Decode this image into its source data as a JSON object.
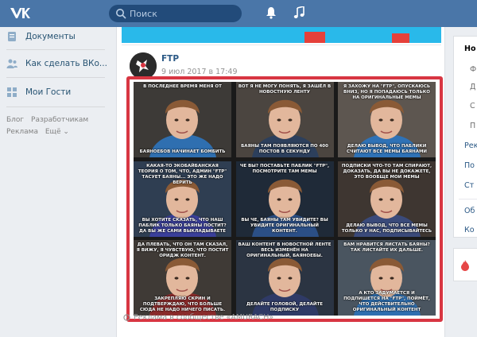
{
  "header": {
    "logo": "VK",
    "search_placeholder": "Поиск",
    "icons": [
      "vk-logo-icon",
      "search-icon",
      "bell-icon",
      "music-icon"
    ],
    "colors": {
      "header_bg": "#4a76a8",
      "search_bg": "#224b7a"
    }
  },
  "sidebar": {
    "items": [
      {
        "label": "Документы",
        "icon": "document-icon"
      },
      {
        "label": "Как сделать ВКо...",
        "icon": "users-icon"
      },
      {
        "label": "Мои Гости",
        "icon": "grid-icon"
      }
    ],
    "footer_links": [
      "Блог",
      "Разработчикам",
      "Реклама",
      "Ещё ⌄"
    ]
  },
  "post": {
    "author": "FTP",
    "date": "9 июл 2017 в 17:49",
    "meme": {
      "cells": [
        {
          "top": "В ПОСЛЕДНЕЕ ВРЕМЯ МЕНЯ ОТ",
          "bottom": "БАЯНОЕБОВ НАЧИНАЕТ БОМБИТЬ"
        },
        {
          "top": "ВОТ Я НЕ МОГУ ПОНЯТЬ, Я ЗАШЁЛ В НОВОСТНУЮ ЛЕНТУ",
          "bottom": "БАЯНЫ ТАМ ПОЯВЛЯЮТСЯ ПО 400 ПОСТОВ В СЕКУНДУ"
        },
        {
          "top": "Я ЗАХОЖУ НА \"FTP\", ОПУСКАЮСЬ ВНИЗ, НО Я ПОПАДАЮСЬ ТОЛЬКО НА ОРИГИНАЛЬНЫЕ МЕМЫ",
          "bottom": "ДЕЛАЮ ВЫВОД, ЧТО ПАБЛИКИ СЧИТАЮТ ВСЕ МЕМЫ БАЯНАМИ"
        },
        {
          "top": "КАКАЯ-ТО ЭКОБАЙБАНСКАЯ ТЕОРИЯ О ТОМ, ЧТО, АДМИН \"FTP\" ТАСУЕТ БАЯНЫ... ЭТО ЖЕ НАДО ВЕРИТЬ",
          "bottom": "ВЫ ХОТИТЕ СКАЗАТЬ, ЧТО НАШ ПАБЛИК ТОЛЬКО БАЯНЫ ПОСТИТ? ДА ВЫ ЖЕ САМИ ВЫКЛАДЫВАЕТЕ"
        },
        {
          "top": "ЧЕ ВЫ? ПОСТАВЬТЕ ПАБЛИК \"FTP\", ПОСМОТРИТЕ ТАМ МЕМЫ",
          "bottom": "ВЫ ЧЕ, БАЯНЫ ТАМ УВИДИТЕ? ВЫ УВИДИТЕ ОРИГИНАЛЬНЫЙ КОНТЕНТ."
        },
        {
          "top": "ПОДПИСКИ ЧТО-ТО ТАМ СПИРАЮТ, ДОКАЗАТЬ, ДА ВЫ НЕ ДОКАЖЕТЕ, ЭТО ВООБЩЕ МОИ МЕМЫ",
          "bottom": "ДЕЛАЮ ВЫВОД, ЧТО ВСЕ МЕМЫ ТОЛЬКО У НАС, ПОДПИСЫВАЙТЕСЬ"
        },
        {
          "top": "ДА ПЛЕВАТЬ, ЧТО ОН ТАМ СКАЗАЛ, Я ВИЖУ, Я ЧУВСТВУЮ, ЧТО ПОСТИТ ОРИДЖ КОНТЕНТ.",
          "bottom": "ЗАКРЕПЛЯЮ СКРИН И ПОДТВЕРЖДАЮ, ЧТО БОЛЬШЕ СЮДА НЕ НАДО НИЧЕГО ПИСАТЬ."
        },
        {
          "top": "ВАШ КОНТЕНТ В НОВОСТНОЙ ЛЕНТЕ ВЕСЬ ИЗМЕНЁН НА ОРИГИНАЛЬНЫЙ, БАЯНОЕБЫ.",
          "bottom": "ДЕЛАЙТЕ ГОЛОВОЙ, ДЕЛАЙТЕ ПОДПИСКУ"
        },
        {
          "top": "ВАМ НРАВИТСЯ ЛИСТАТЬ БАЯНЫ? ТАК ЛИСТАЙТЕ ИХ ДАЛЬШЕ.",
          "bottom": "А КТО ЗАДУМАЕТСЯ И ПОДПИШЕТСЯ НА \"FTP\", ПОЙМЁТ, ЧТО ДЕЙСТВИТЕЛЬНО ОРИГИНАЛЬНЫЙ КОНТЕНТ"
        }
      ]
    },
    "ad_text": "Реклама в сообществе «AMURACH»",
    "colors": {
      "highlight_border": "#d83642",
      "banner": "#29b9ea"
    }
  },
  "right_menu": {
    "items": [
      "Но",
      "Ф",
      "Д",
      "С",
      "П",
      "Рек",
      "По",
      "Ст",
      "Об",
      "Ко"
    ]
  }
}
